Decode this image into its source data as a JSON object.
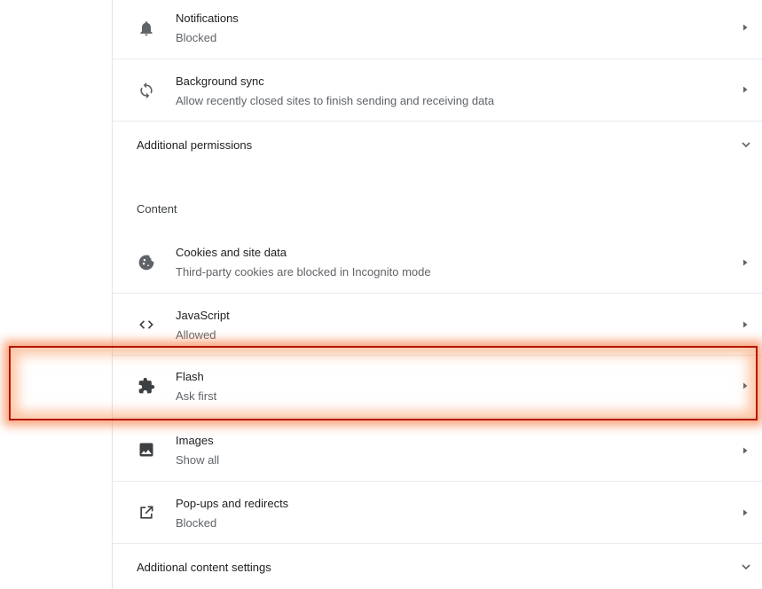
{
  "permissions": {
    "notifications": {
      "title": "Notifications",
      "subtitle": "Blocked",
      "icon": "bell-icon"
    },
    "background_sync": {
      "title": "Background sync",
      "subtitle": "Allow recently closed sites to finish sending and receiving data",
      "icon": "sync-icon"
    },
    "additional": {
      "label": "Additional permissions"
    }
  },
  "content": {
    "heading": "Content",
    "cookies": {
      "title": "Cookies and site data",
      "subtitle": "Third-party cookies are blocked in Incognito mode",
      "icon": "cookie-icon"
    },
    "javascript": {
      "title": "JavaScript",
      "subtitle": "Allowed",
      "icon": "code-icon"
    },
    "flash": {
      "title": "Flash",
      "subtitle": "Ask first",
      "icon": "puzzle-icon"
    },
    "images": {
      "title": "Images",
      "subtitle": "Show all",
      "icon": "image-icon"
    },
    "popups": {
      "title": "Pop-ups and redirects",
      "subtitle": "Blocked",
      "icon": "external-link-icon"
    },
    "additional": {
      "label": "Additional content settings"
    }
  },
  "colors": {
    "text_primary": "#202124",
    "text_secondary": "#5f6368",
    "icon": "#5f6368",
    "divider": "#e8eaed",
    "highlight_border": "#b5170a",
    "highlight_glow": "#f7783c"
  }
}
